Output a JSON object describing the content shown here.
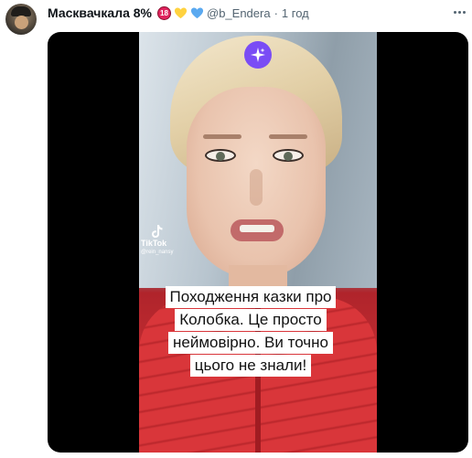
{
  "tweet": {
    "author_name": "Масквачкала 8%",
    "badge_text": "18",
    "handle": "@b_Endera",
    "separator": "·",
    "time": "1 год"
  },
  "media": {
    "icons": [
      "sparkle-icon",
      "tiktok-icon"
    ],
    "tiktok_label": "TikTok",
    "tiktok_user": "@rein_nansy",
    "caption_lines": [
      "Походження казки про",
      "Колобка. Це просто",
      "неймовірно. Ви точно",
      "цього не знали!"
    ]
  },
  "colors": {
    "accent_purple": "#7a4cf5",
    "jacket_red": "#d9363a",
    "heart_yellow": "#ffd23f",
    "heart_blue": "#5aa9f0",
    "badge_red": "#e0245e"
  }
}
